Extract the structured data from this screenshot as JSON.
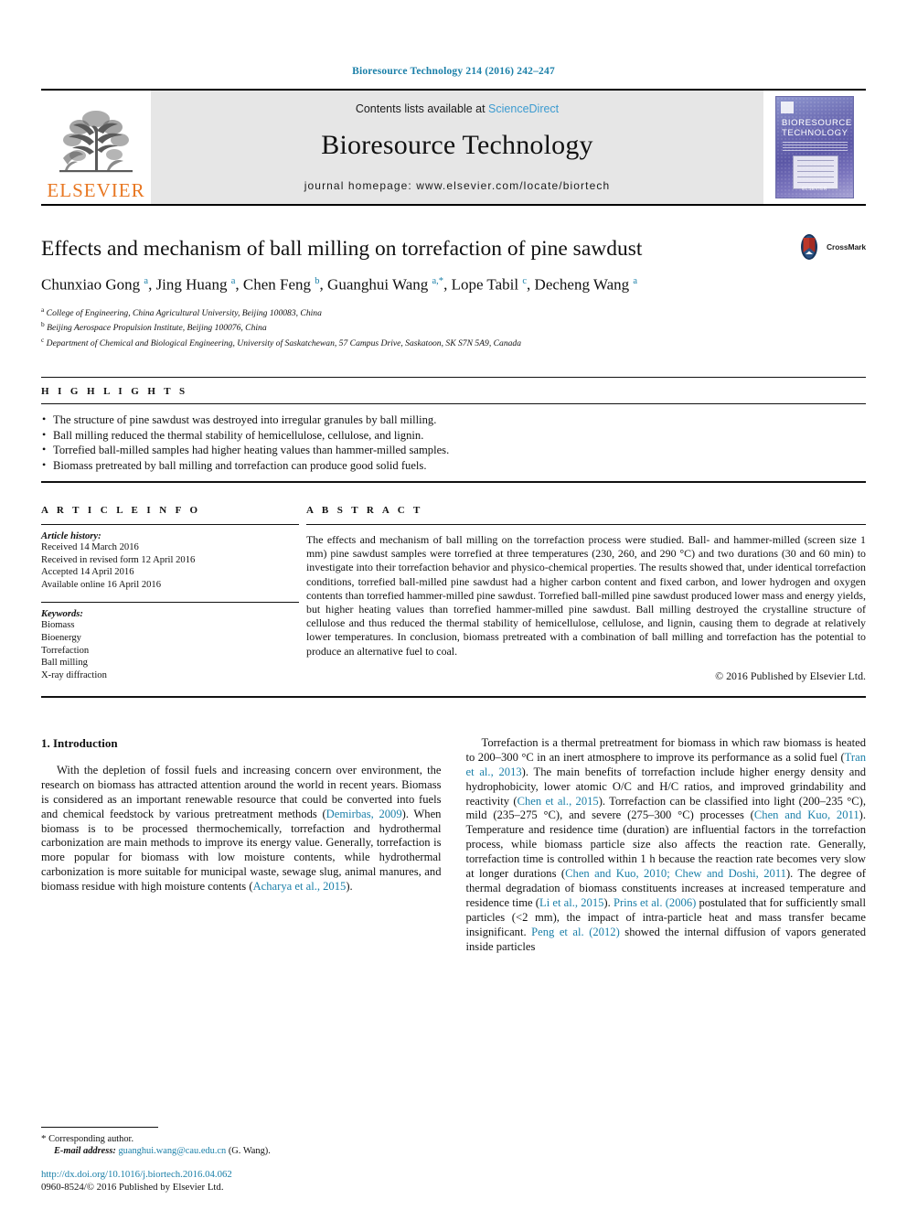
{
  "running_head": "Bioresource Technology 214 (2016) 242–247",
  "masthead": {
    "publisher_logo_text": "ELSEVIER",
    "contents_prefix": "Contents lists available at ",
    "contents_link": "ScienceDirect",
    "journal_title": "Bioresource Technology",
    "homepage": "journal homepage: www.elsevier.com/locate/biortech",
    "cover": {
      "title_line1": "BIORESOURCE",
      "title_line2": "TECHNOLOGY",
      "foot": "ELSEVIER"
    },
    "colors": {
      "link_blue": "#3c9bd0",
      "elsevier_orange": "#e87722",
      "header_blue": "#1a7fa8",
      "band_gray": "#e6e6e6"
    }
  },
  "article": {
    "title": "Effects and mechanism of ball milling on torrefaction of pine sawdust",
    "crossmark_label": "CrossMark",
    "authors_html": "Chunxiao Gong <sup>a</sup>, Jing Huang <sup>a</sup>, Chen Feng <sup>b</sup>, Guanghui Wang <sup>a,*</sup>, Lope Tabil <sup>c</sup>, Decheng Wang <sup>a</sup>",
    "affiliations": [
      {
        "marker": "a",
        "text": "College of Engineering, China Agricultural University, Beijing 100083, China"
      },
      {
        "marker": "b",
        "text": "Beijing Aerospace Propulsion Institute, Beijing 100076, China"
      },
      {
        "marker": "c",
        "text": "Department of Chemical and Biological Engineering, University of Saskatchewan, 57 Campus Drive, Saskatoon, SK S7N 5A9, Canada"
      }
    ]
  },
  "highlights": {
    "heading": "H I G H L I G H T S",
    "items": [
      "The structure of pine sawdust was destroyed into irregular granules by ball milling.",
      "Ball milling reduced the thermal stability of hemicellulose, cellulose, and lignin.",
      "Torrefied ball-milled samples had higher heating values than hammer-milled samples.",
      "Biomass pretreated by ball milling and torrefaction can produce good solid fuels."
    ]
  },
  "article_info": {
    "heading": "A R T I C L E    I N F O",
    "history_title": "Article history:",
    "history": [
      "Received 14 March 2016",
      "Received in revised form 12 April 2016",
      "Accepted 14 April 2016",
      "Available online 16 April 2016"
    ],
    "keywords_title": "Keywords:",
    "keywords": [
      "Biomass",
      "Bioenergy",
      "Torrefaction",
      "Ball milling",
      "X-ray diffraction"
    ]
  },
  "abstract": {
    "heading": "A B S T R A C T",
    "text": "The effects and mechanism of ball milling on the torrefaction process were studied. Ball- and hammer-milled (screen size 1 mm) pine sawdust samples were torrefied at three temperatures (230, 260, and 290 °C) and two durations (30 and 60 min) to investigate into their torrefaction behavior and physico-chemical properties. The results showed that, under identical torrefaction conditions, torrefied ball-milled pine sawdust had a higher carbon content and fixed carbon, and lower hydrogen and oxygen contents than torrefied hammer-milled pine sawdust. Torrefied ball-milled pine sawdust produced lower mass and energy yields, but higher heating values than torrefied hammer-milled pine sawdust. Ball milling destroyed the crystalline structure of cellulose and thus reduced the thermal stability of hemicellulose, cellulose, and lignin, causing them to degrade at relatively lower temperatures. In conclusion, biomass pretreated with a combination of ball milling and torrefaction has the potential to produce an alternative fuel to coal.",
    "copyright": "© 2016 Published by Elsevier Ltd."
  },
  "introduction": {
    "section_heading": "1. Introduction",
    "left_paragraph_html": "With the depletion of fossil fuels and increasing concern over environment, the research on biomass has attracted attention around the world in recent years. Biomass is considered as an important renewable resource that could be converted into fuels and chemical feedstock by various pretreatment methods (<span class=\"cit\">Demirbas, 2009</span>). When biomass is to be processed thermochemically, torrefaction and hydrothermal carbonization are main methods to improve its energy value. Generally, torrefaction is more popular for biomass with low moisture contents, while hydrothermal carbonization is more suitable for municipal waste, sewage slug, animal manures, and biomass residue with high moisture contents (<span class=\"cit\">Acharya et al., 2015</span>).",
    "right_paragraph_html": "Torrefaction is a thermal pretreatment for biomass in which raw biomass is heated to 200–300 °C in an inert atmosphere to improve its performance as a solid fuel (<span class=\"cit\">Tran et al., 2013</span>). The main benefits of torrefaction include higher energy density and hydrophobicity, lower atomic O/C and H/C ratios, and improved grindability and reactivity (<span class=\"cit\">Chen et al., 2015</span>). Torrefaction can be classified into light (200–235 °C), mild (235–275 °C), and severe (275–300 °C) processes (<span class=\"cit\">Chen and Kuo, 2011</span>). Temperature and residence time (duration) are influential factors in the torrefaction process, while biomass particle size also affects the reaction rate. Generally, torrefaction time is controlled within 1 h because the reaction rate becomes very slow at longer durations (<span class=\"cit\">Chen and Kuo, 2010; Chew and Doshi, 2011</span>). The degree of thermal degradation of biomass constituents increases at increased temperature and residence time (<span class=\"cit\">Li et al., 2015</span>). <span class=\"cit\">Prins et al. (2006)</span> postulated that for sufficiently small particles (&lt;2 mm), the impact of intra-particle heat and mass transfer became insignificant. <span class=\"cit\">Peng et al. (2012)</span> showed the internal diffusion of vapors generated inside particles"
  },
  "footer": {
    "corresponding_marker": "*",
    "corresponding_text": "Corresponding author.",
    "email_label": "E-mail address:",
    "email": "guanghui.wang@cau.edu.cn",
    "email_suffix": "(G. Wang).",
    "doi": "http://dx.doi.org/10.1016/j.biortech.2016.04.062",
    "issn_line": "0960-8524/© 2016 Published by Elsevier Ltd."
  }
}
